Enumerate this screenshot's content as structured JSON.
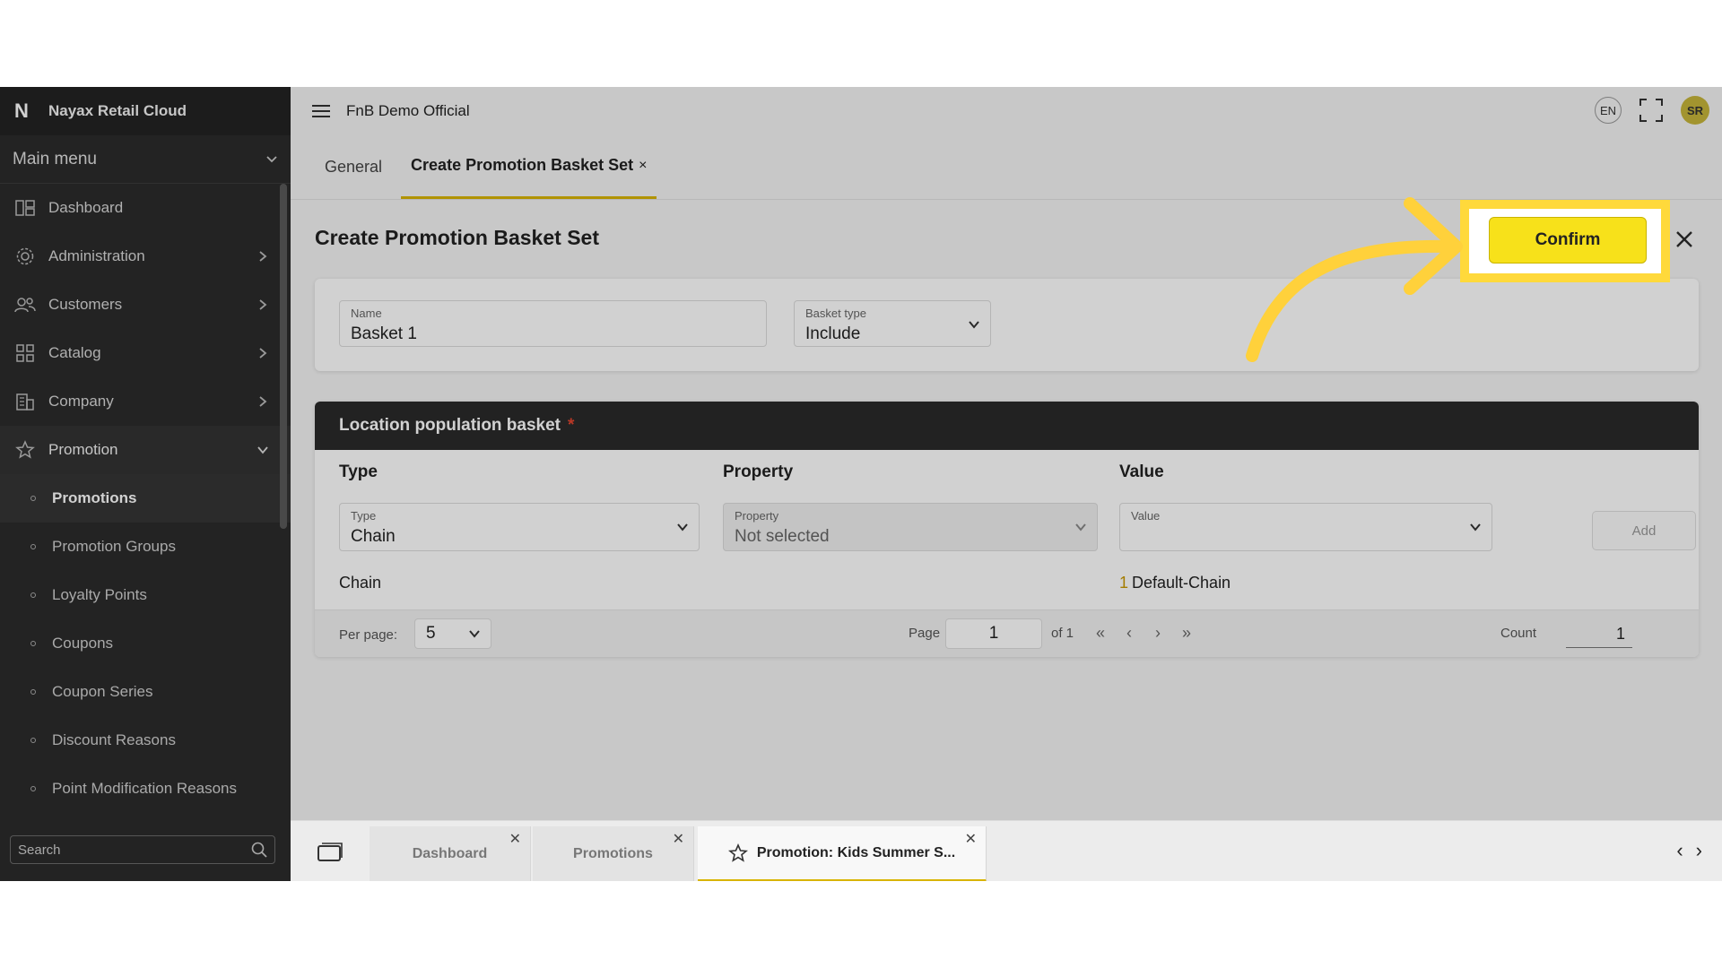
{
  "brand": {
    "name": "Nayax Retail Cloud",
    "logo": "N"
  },
  "sidebar": {
    "main_menu_label": "Main menu",
    "items": [
      {
        "label": "Dashboard",
        "icon": "dashboard-icon"
      },
      {
        "label": "Administration",
        "icon": "admin-gear-icon"
      },
      {
        "label": "Customers",
        "icon": "customers-icon"
      },
      {
        "label": "Catalog",
        "icon": "catalog-grid-icon"
      },
      {
        "label": "Company",
        "icon": "company-building-icon"
      },
      {
        "label": "Promotion",
        "icon": "star-icon"
      }
    ],
    "sub_items": [
      {
        "label": "Promotions"
      },
      {
        "label": "Promotion Groups"
      },
      {
        "label": "Loyalty Points"
      },
      {
        "label": "Coupons"
      },
      {
        "label": "Coupon Series"
      },
      {
        "label": "Discount Reasons"
      },
      {
        "label": "Point Modification Reasons"
      }
    ],
    "search_placeholder": "Search"
  },
  "topbar": {
    "company": "FnB Demo Official",
    "language": "EN",
    "avatar_initials": "SR"
  },
  "tabs": [
    {
      "label": "General"
    },
    {
      "label": "Create Promotion Basket Set",
      "close": "×"
    }
  ],
  "page": {
    "title": "Create Promotion Basket Set",
    "confirm_label": "Confirm",
    "name_field": {
      "label": "Name",
      "value": "Basket 1"
    },
    "basket_type": {
      "label": "Basket type",
      "value": "Include"
    }
  },
  "location_basket": {
    "title": "Location population basket",
    "required_mark": "*",
    "columns": [
      "Type",
      "Property",
      "Value"
    ],
    "type_select": {
      "label": "Type",
      "value": "Chain"
    },
    "property_select": {
      "label": "Property",
      "value": "Not selected"
    },
    "value_select": {
      "label": "Value",
      "value": ""
    },
    "add_label": "Add",
    "row": {
      "type": "Chain",
      "value_num": "1",
      "value_text": "Default-Chain"
    },
    "pager": {
      "per_page_label": "Per page:",
      "per_page": "5",
      "page_label": "Page",
      "page": "1",
      "of_label": "of 1",
      "count_label": "Count",
      "count": "1"
    }
  },
  "bottom_tabs": [
    {
      "label": "Dashboard"
    },
    {
      "label": "Promotions"
    },
    {
      "label": "Promotion: Kids Summer S..."
    }
  ],
  "colors": {
    "accent_yellow": "#f7e11a",
    "highlight": "#ffd93b",
    "sidebar_bg": "#2b2b2b"
  }
}
